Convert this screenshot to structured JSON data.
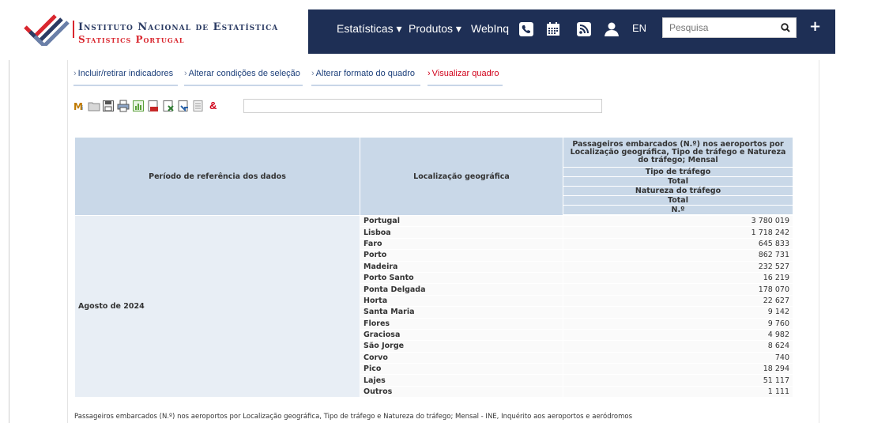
{
  "brand": {
    "line1": "Instituto Nacional de Estatística",
    "line2": "Statistics Portugal"
  },
  "nav": {
    "items": [
      "Estatísticas ▾",
      "Produtos ▾",
      "WebInq"
    ],
    "lang": "EN",
    "search_placeholder": "Pesquisa",
    "plus": "+"
  },
  "tabs": [
    {
      "label": "Incluir/retirar indicadores",
      "active": false
    },
    {
      "label": "Alterar condições de seleção",
      "active": false
    },
    {
      "label": "Alterar formato do quadro",
      "active": false
    },
    {
      "label": "Visualizar quadro",
      "active": true
    }
  ],
  "toolbar": {
    "amp": "&"
  },
  "table": {
    "col_period": "Período de referência dos dados",
    "col_location": "Localização geográfica",
    "indicator_title": "Passageiros embarcados (N.º) nos aeroportos por Localização geográfica, Tipo de tráfego e Natureza do tráfego; Mensal",
    "dim1_label": "Tipo de tráfego",
    "dim1_value": "Total",
    "dim2_label": "Natureza do tráfego",
    "dim2_value": "Total",
    "unit": "N.º",
    "period": "Agosto de 2024",
    "rows": [
      {
        "location": "Portugal",
        "value": "3 780 019"
      },
      {
        "location": "Lisboa",
        "value": "1 718 242"
      },
      {
        "location": "Faro",
        "value": "645 833"
      },
      {
        "location": "Porto",
        "value": "862 731"
      },
      {
        "location": "Madeira",
        "value": "232 527"
      },
      {
        "location": "Porto Santo",
        "value": "16 219"
      },
      {
        "location": "Ponta Delgada",
        "value": "178 070"
      },
      {
        "location": "Horta",
        "value": "22 627"
      },
      {
        "location": "Santa Maria",
        "value": "9 142"
      },
      {
        "location": "Flores",
        "value": "9 760"
      },
      {
        "location": "Graciosa",
        "value": "4 982"
      },
      {
        "location": "São Jorge",
        "value": "8 624"
      },
      {
        "location": "Corvo",
        "value": "740"
      },
      {
        "location": "Pico",
        "value": "18 294"
      },
      {
        "location": "Lajes",
        "value": "51 117"
      },
      {
        "location": "Outros",
        "value": "1 111"
      }
    ]
  },
  "footnote": "Passageiros embarcados (N.º) nos aeroportos por Localização geográfica, Tipo de tráfego e Natureza do tráfego; Mensal - INE, Inquérito aos aeroportos e aeródromos",
  "colors": {
    "navbar": "#1e2f55",
    "brand_red": "#d9262e",
    "header_cell": "#c9d8e8",
    "active_tab": "#d0021b"
  },
  "icons": [
    "ine-logo-icon",
    "phone-icon",
    "calendar-icon",
    "rss-icon",
    "user-icon",
    "search-icon"
  ]
}
